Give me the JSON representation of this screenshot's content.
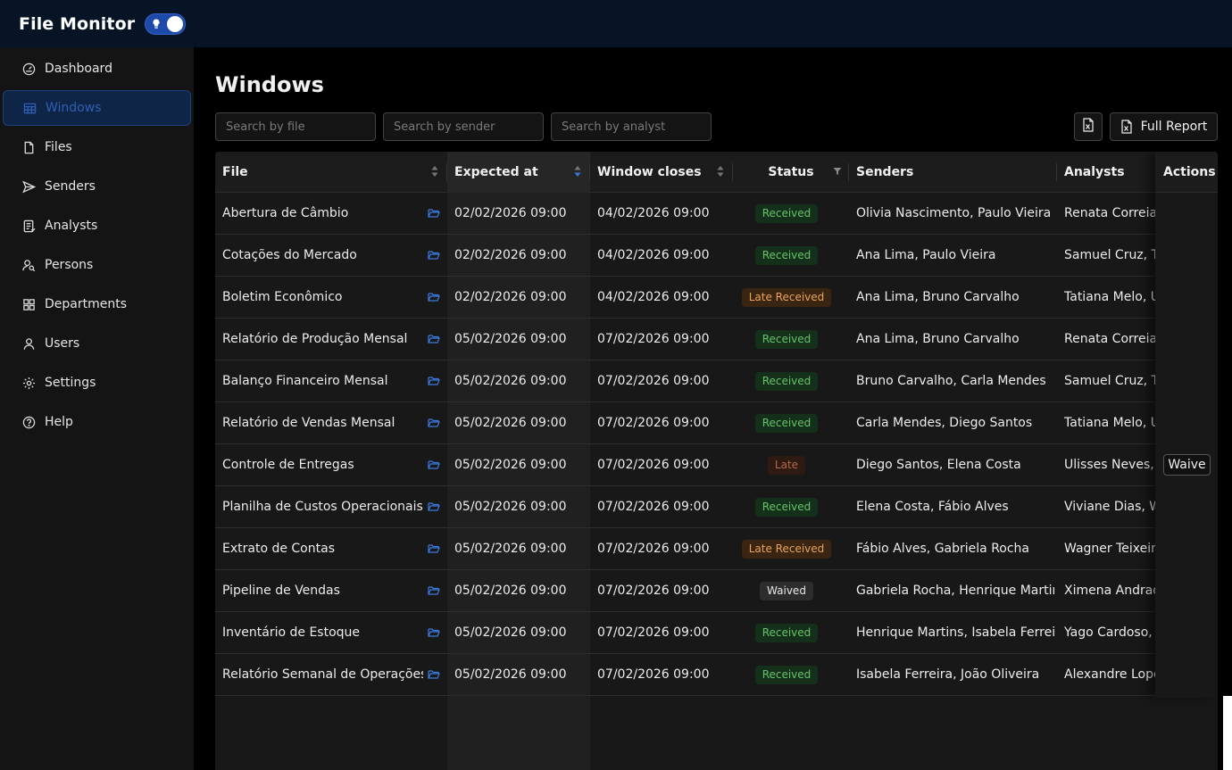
{
  "app": {
    "title": "File Monitor"
  },
  "sidebar": {
    "items": [
      {
        "label": "Dashboard",
        "icon": "gauge-icon"
      },
      {
        "label": "Windows",
        "icon": "calendar-grid-icon"
      },
      {
        "label": "Files",
        "icon": "file-icon"
      },
      {
        "label": "Senders",
        "icon": "send-icon"
      },
      {
        "label": "Analysts",
        "icon": "clipboard-icon"
      },
      {
        "label": "Persons",
        "icon": "person-search-icon"
      },
      {
        "label": "Departments",
        "icon": "grid-icon"
      },
      {
        "label": "Users",
        "icon": "user-icon"
      },
      {
        "label": "Settings",
        "icon": "gear-icon"
      },
      {
        "label": "Help",
        "icon": "help-circle-icon"
      }
    ],
    "active": "Windows"
  },
  "page": {
    "title": "Windows"
  },
  "filters": {
    "file_placeholder": "Search by file",
    "sender_placeholder": "Search by sender",
    "analyst_placeholder": "Search by analyst"
  },
  "toolbar": {
    "full_report_label": "Full Report"
  },
  "table": {
    "columns": [
      "File",
      "Expected at",
      "Window closes",
      "Status",
      "Senders",
      "Analysts",
      "Actions"
    ],
    "rows": [
      {
        "file": "Abertura de Câmbio",
        "expected": "02/02/2026 09:00",
        "closes": "04/02/2026 09:00",
        "status": "Received",
        "senders": "Olivia Nascimento, Paulo Vieira",
        "analysts": "Renata Correia, S",
        "action": ""
      },
      {
        "file": "Cotações do Mercado",
        "expected": "02/02/2026 09:00",
        "closes": "04/02/2026 09:00",
        "status": "Received",
        "senders": "Ana Lima, Paulo Vieira",
        "analysts": "Samuel Cruz, Tat",
        "action": ""
      },
      {
        "file": "Boletim Econômico",
        "expected": "02/02/2026 09:00",
        "closes": "04/02/2026 09:00",
        "status": "Late Received",
        "senders": "Ana Lima, Bruno Carvalho",
        "analysts": "Tatiana Melo, Uli",
        "action": ""
      },
      {
        "file": "Relatório de Produção Mensal",
        "expected": "05/02/2026 09:00",
        "closes": "07/02/2026 09:00",
        "status": "Received",
        "senders": "Ana Lima, Bruno Carvalho",
        "analysts": "Renata Correia, S",
        "action": ""
      },
      {
        "file": "Balanço Financeiro Mensal",
        "expected": "05/02/2026 09:00",
        "closes": "07/02/2026 09:00",
        "status": "Received",
        "senders": "Bruno Carvalho, Carla Mendes",
        "analysts": "Samuel Cruz, Tat",
        "action": ""
      },
      {
        "file": "Relatório de Vendas Mensal",
        "expected": "05/02/2026 09:00",
        "closes": "07/02/2026 09:00",
        "status": "Received",
        "senders": "Carla Mendes, Diego Santos",
        "analysts": "Tatiana Melo, Uli",
        "action": ""
      },
      {
        "file": "Controle de Entregas",
        "expected": "05/02/2026 09:00",
        "closes": "07/02/2026 09:00",
        "status": "Late",
        "senders": "Diego Santos, Elena Costa",
        "analysts": "Ulisses Neves, Vi",
        "action": "Waive"
      },
      {
        "file": "Planilha de Custos Operacionais",
        "expected": "05/02/2026 09:00",
        "closes": "07/02/2026 09:00",
        "status": "Received",
        "senders": "Elena Costa, Fábio Alves",
        "analysts": "Viviane Dias, Wa",
        "action": ""
      },
      {
        "file": "Extrato de Contas",
        "expected": "05/02/2026 09:00",
        "closes": "07/02/2026 09:00",
        "status": "Late Received",
        "senders": "Fábio Alves, Gabriela Rocha",
        "analysts": "Wagner Teixeira,",
        "action": ""
      },
      {
        "file": "Pipeline de Vendas",
        "expected": "05/02/2026 09:00",
        "closes": "07/02/2026 09:00",
        "status": "Waived",
        "senders": "Gabriela Rocha, Henrique Martins",
        "analysts": "Ximena Andrade",
        "action": ""
      },
      {
        "file": "Inventário de Estoque",
        "expected": "05/02/2026 09:00",
        "closes": "07/02/2026 09:00",
        "status": "Received",
        "senders": "Henrique Martins, Isabela Ferreira",
        "analysts": "Yago Cardoso, Zo",
        "action": ""
      },
      {
        "file": "Relatório Semanal de Operações",
        "expected": "05/02/2026 09:00",
        "closes": "07/02/2026 09:00",
        "status": "Received",
        "senders": "Isabela Ferreira, João Oliveira",
        "analysts": "Alexandre Lopes",
        "action": ""
      }
    ]
  },
  "colors": {
    "accent": "#2f5fb2",
    "received": "#66c26a",
    "late_received": "#e8a35c",
    "late": "#b26a44",
    "folder_icon": "#3b7be0"
  }
}
